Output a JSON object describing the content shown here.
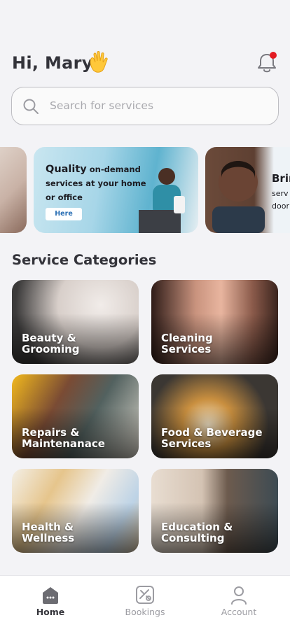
{
  "header": {
    "greeting": "Hi, Mary",
    "wave_icon": "waving-hand-emoji",
    "bell_icon": "bell-icon",
    "notification_dot_color": "#e31b23"
  },
  "search": {
    "placeholder": "Search for services",
    "icon": "search-icon"
  },
  "carousel": {
    "banners": [
      {
        "highlight": "Quality",
        "text": "on-demand services at your home or office",
        "button_label": "Here"
      },
      {
        "title_partial": "Brin",
        "subtitle_partial": [
          "serv",
          "door"
        ]
      }
    ]
  },
  "categories": {
    "title": "Service Categories",
    "items": [
      {
        "line1": "Beauty &",
        "line2": "Grooming"
      },
      {
        "line1": "Cleaning",
        "line2": "Services"
      },
      {
        "line1": "Repairs &",
        "line2": "Maintenanace"
      },
      {
        "line1": "Food & Beverage",
        "line2": "Services"
      },
      {
        "line1": "Health &",
        "line2": "Wellness"
      },
      {
        "line1": "Education &",
        "line2": "Consulting"
      }
    ]
  },
  "tabbar": {
    "tabs": [
      {
        "label": "Home",
        "icon": "home-icon",
        "active": true
      },
      {
        "label": "Bookings",
        "icon": "bookings-icon",
        "active": false
      },
      {
        "label": "Account",
        "icon": "account-icon",
        "active": false
      }
    ]
  },
  "colors": {
    "background": "#f3f3f6",
    "here_button_text": "#2a6fb4",
    "active_tab": "#34343a",
    "inactive_tab": "#9c9ca2"
  }
}
